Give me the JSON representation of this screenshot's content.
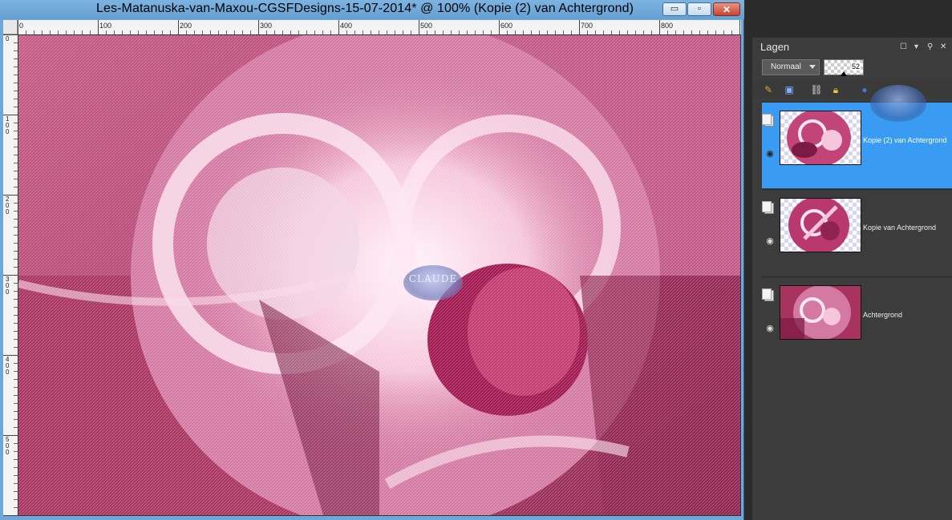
{
  "window": {
    "title": "Les-Matanuska-van-Maxou-CGSFDesigns-15-07-2014* @ 100% (Kopie (2) van Achtergrond)",
    "buttons": {
      "minimize": "▭",
      "maximize": "▫",
      "close": "✕"
    }
  },
  "ruler": {
    "horizontal_labels": [
      "0",
      "100",
      "200",
      "300",
      "400",
      "500",
      "600",
      "700",
      "800"
    ],
    "vertical_labels": [
      "0",
      "100",
      "200",
      "300",
      "400",
      "500"
    ]
  },
  "canvas": {
    "watermark_text": "CLAUDE",
    "colors": {
      "deep": "#7a1a45",
      "mid": "#c2457a",
      "light": "#f6c6dc",
      "white": "#fff4fa"
    }
  },
  "layers_panel": {
    "title": "Lagen",
    "blend_mode": "Normaal",
    "opacity": "52",
    "toolbar_icons": [
      "new-layer-icon",
      "mask-icon",
      "link-icon",
      "lock-icon",
      "circle-icon"
    ],
    "layers": [
      {
        "name": "Kopie (2) van Achtergrond",
        "selected": true
      },
      {
        "name": "Kopie van Achtergrond",
        "selected": false
      },
      {
        "name": "Achtergrond",
        "selected": false
      }
    ]
  }
}
